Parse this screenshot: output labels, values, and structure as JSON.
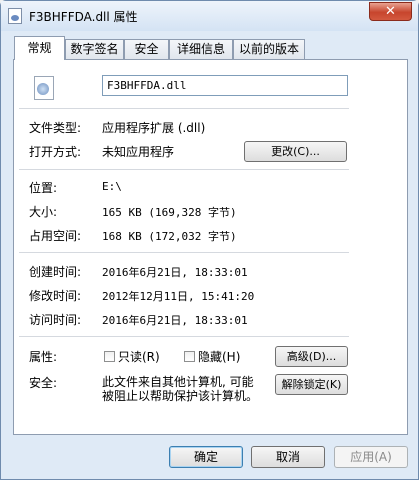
{
  "window": {
    "title": "F3BHFFDA.dll 属性",
    "close_glyph": "✕"
  },
  "tabs": [
    {
      "label": "常规"
    },
    {
      "label": "数字签名"
    },
    {
      "label": "安全"
    },
    {
      "label": "详细信息"
    },
    {
      "label": "以前的版本"
    }
  ],
  "general": {
    "file_name": "F3BHFFDA.dll",
    "file_type_label": "文件类型:",
    "file_type_value": "应用程序扩展 (.dll)",
    "open_with_label": "打开方式:",
    "open_with_value": "未知应用程序",
    "change_button": "更改(C)...",
    "location_label": "位置:",
    "location_value": "E:\\",
    "size_label": "大小:",
    "size_value": "165 KB (169,328 字节)",
    "disk_size_label": "占用空间:",
    "disk_size_value": "168 KB (172,032 字节)",
    "created_label": "创建时间:",
    "created_value": "2016年6月21日, 18:33:01",
    "modified_label": "修改时间:",
    "modified_value": "2012年12月11日, 15:41:20",
    "accessed_label": "访问时间:",
    "accessed_value": "2016年6月21日, 18:33:01",
    "attributes_label": "属性:",
    "readonly_label": "只读(R)",
    "hidden_label": "隐藏(H)",
    "advanced_button": "高级(D)...",
    "security_label": "安全:",
    "security_text_line1": "此文件来自其他计算机, 可能",
    "security_text_line2": "被阻止以帮助保护该计算机。",
    "unblock_button": "解除锁定(K)"
  },
  "footer": {
    "ok_button": "确定",
    "cancel_button": "取消",
    "apply_button": "应用(A)"
  },
  "colors": {
    "accent": "#3c7fb1",
    "close": "#c7452d"
  }
}
